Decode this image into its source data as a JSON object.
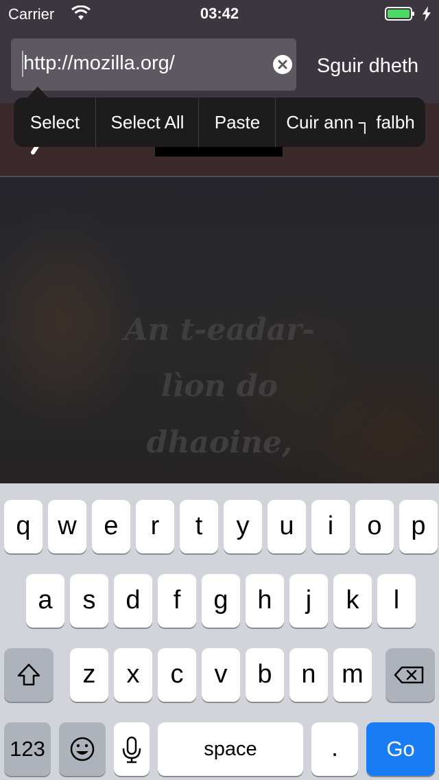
{
  "status": {
    "carrier": "Carrier",
    "time": "03:42",
    "battery_color": "#4cd964"
  },
  "url_bar": {
    "url": "http://mozilla.org/",
    "clear_icon": "clear-circle-icon",
    "cancel_label": "Sguir dheth"
  },
  "edit_menu": {
    "items": [
      "Select",
      "Select All",
      "Paste",
      "Cuir ann ┐ falbh"
    ]
  },
  "content": {
    "hero_heading": [
      "An t-eadar-",
      "lìon do",
      "dhaoine,"
    ]
  },
  "keyboard": {
    "row1": [
      "q",
      "w",
      "e",
      "r",
      "t",
      "y",
      "u",
      "i",
      "o",
      "p"
    ],
    "row2": [
      "a",
      "s",
      "d",
      "f",
      "g",
      "h",
      "j",
      "k",
      "l"
    ],
    "row3": [
      "z",
      "x",
      "c",
      "v",
      "b",
      "n",
      "m"
    ],
    "numbers_label": "123",
    "space_label": "space",
    "period_label": ".",
    "go_label": "Go",
    "accent_color": "#1a7cf5"
  }
}
